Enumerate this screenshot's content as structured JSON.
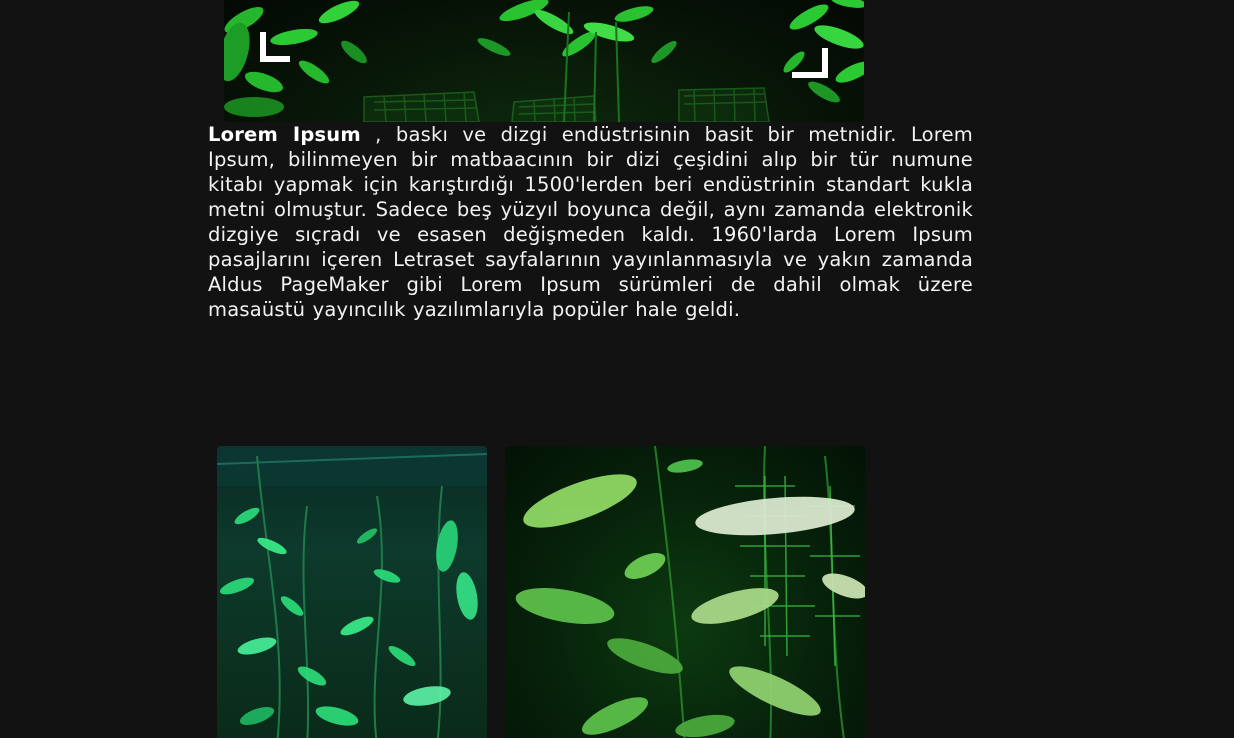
{
  "article": {
    "lead": "Lorem Ipsum",
    "body": " , baskı ve dizgi endüstrisinin basit bir metnidir. Lorem Ipsum, bilinmeyen bir matbaacının bir dizi çeşidini alıp bir tür numune kitabı yapmak için karıştırdığı 1500'lerden beri endüstrinin standart kukla metni olmuştur. Sadece beş yüzyıl boyunca değil, aynı zamanda elektronik dizgiye sıçradı ve esasen değişmeden kaldı. 1960'larda Lorem Ipsum pasajlarını içeren Letraset sayfalarının yayınlanmasıyla ve yakın zamanda Aldus PageMaker gibi Lorem Ipsum sürümleri de dahil olmak üzere masaüstü yayıncılık yazılımlarıyla popüler hale geldi."
  },
  "colors": {
    "background": "#121212",
    "text": "#f2f2f2",
    "plant_green": "#2fd03a",
    "plant_teal": "#34e0a0",
    "frame_white": "#ffffff"
  }
}
